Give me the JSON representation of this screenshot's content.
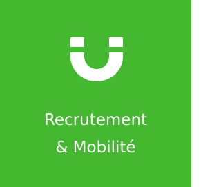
{
  "tile": {
    "line1": "Recrutement",
    "line2": "& Mobilité",
    "icon": "magnet-u-icon",
    "colors": {
      "background": "#44b82f",
      "foreground": "#ffffff"
    }
  }
}
